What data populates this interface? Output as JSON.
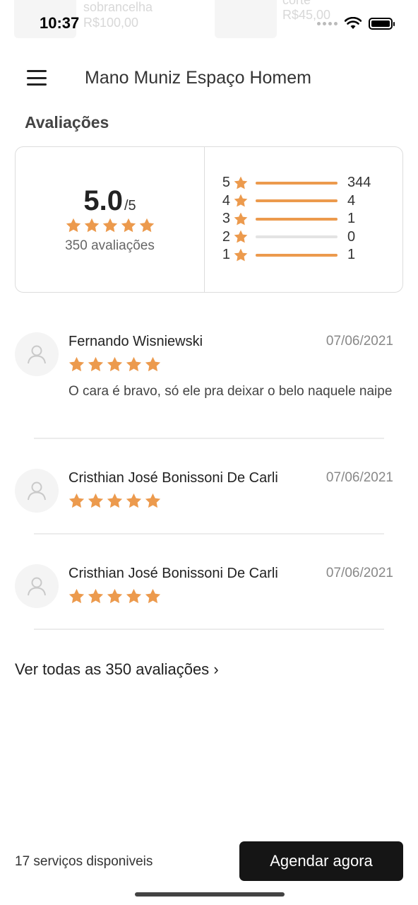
{
  "ghost": {
    "item1_name": "sobrancelha",
    "item1_price": "R$100,00",
    "item2_name": "corte",
    "item2_price": "R$45,00"
  },
  "status": {
    "time": "10:37"
  },
  "header": {
    "title": "Mano Muniz Espaço Homem"
  },
  "section": {
    "title": "Avaliações"
  },
  "summary": {
    "score": "5.0",
    "score_suffix": "/5",
    "count_label": "350 avaliações",
    "distribution": [
      {
        "stars": "5",
        "count": "344",
        "fraction": 1.0
      },
      {
        "stars": "4",
        "count": "4",
        "fraction": 1.0
      },
      {
        "stars": "3",
        "count": "1",
        "fraction": 1.0
      },
      {
        "stars": "2",
        "count": "0",
        "fraction": 0.0
      },
      {
        "stars": "1",
        "count": "1",
        "fraction": 1.0
      }
    ]
  },
  "reviews": [
    {
      "name": "Fernando Wisniewski",
      "date": "07/06/2021",
      "rating": 5,
      "text": "O cara é bravo, só ele pra deixar o belo naquele naipe"
    },
    {
      "name": "Cristhian José Bonissoni De Carli",
      "date": "07/06/2021",
      "rating": 5,
      "text": ""
    },
    {
      "name": "Cristhian José Bonissoni De Carli",
      "date": "07/06/2021",
      "rating": 5,
      "text": ""
    }
  ],
  "see_all": {
    "label": "Ver todas as 350 avaliações",
    "chevron": "›"
  },
  "footer": {
    "services_label": "17 serviços disponiveis",
    "cta_label": "Agendar agora"
  },
  "colors": {
    "star": "#ec9a4d",
    "cta_bg": "#151515"
  }
}
